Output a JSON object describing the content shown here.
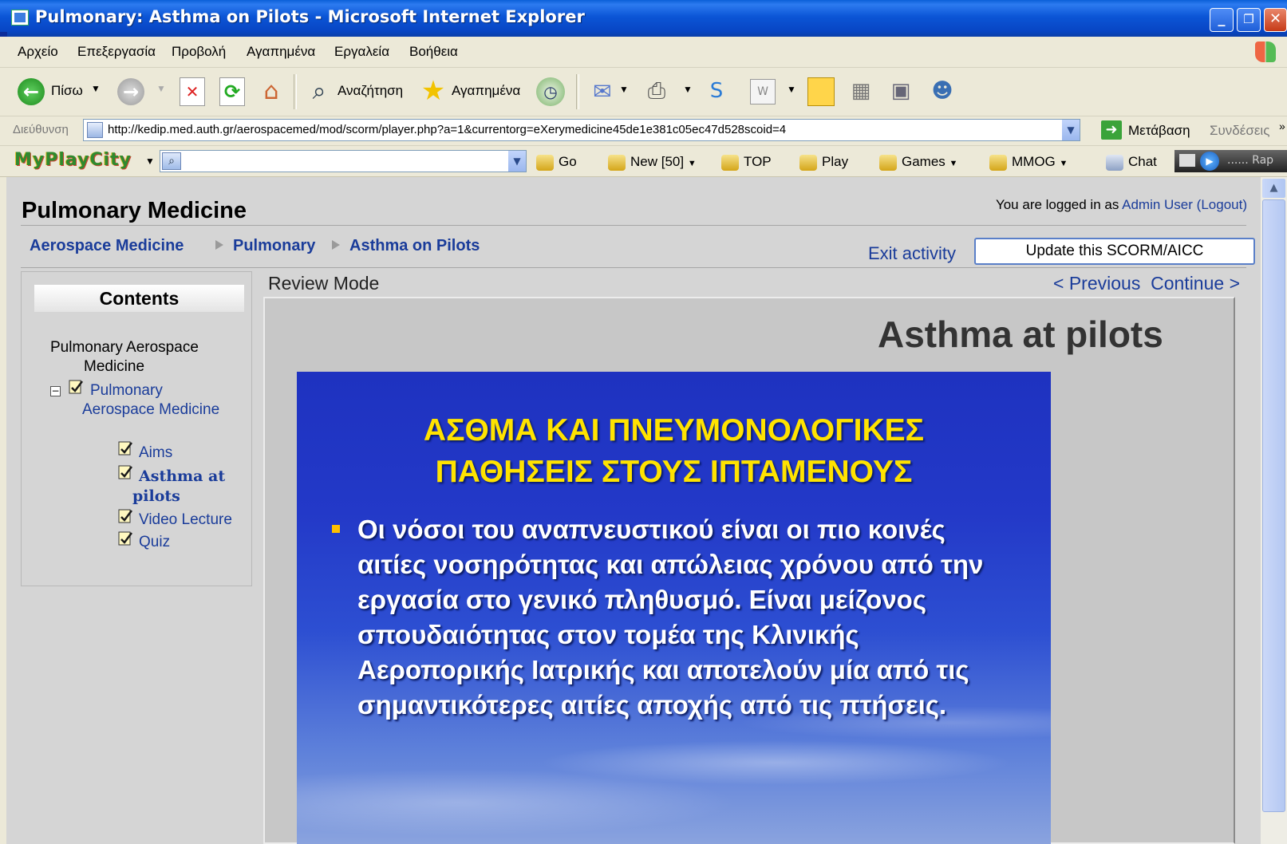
{
  "window": {
    "title": "Pulmonary: Asthma on Pilots - Microsoft Internet Explorer",
    "minimize": "_",
    "restore": "❐",
    "close": "✕"
  },
  "menu": [
    "Αρχείο",
    "Επεξεργασία",
    "Προβολή",
    "Αγαπημένα",
    "Εργαλεία",
    "Βοήθεια"
  ],
  "toolbar": {
    "back_label": "Πίσω",
    "search_label": "Αναζήτηση",
    "favorites_label": "Αγαπημένα"
  },
  "address": {
    "label": "Διεύθυνση",
    "url": "http://kedip.med.auth.gr/aerospacemed/mod/scorm/player.php?a=1&currentorg=eXerymedicine45de1e381c05ec47d528scoid=4",
    "go_label": "Μετάβαση",
    "links_label": "Συνδέσεις"
  },
  "linkbar": {
    "logo": "MyPlayCity",
    "go": "Go",
    "new": "New",
    "new_count": "[50]",
    "top": "TOP",
    "play": "Play",
    "games": "Games",
    "mmog": "MMOG",
    "chat": "Chat",
    "media_text": "...... Rap"
  },
  "page": {
    "site_title": "Pulmonary Medicine",
    "logged_prefix": "You are logged in as ",
    "user_name": "Admin User",
    "logout": "(Logout)",
    "breadcrumb": [
      "Aerospace Medicine",
      "Pulmonary",
      "Asthma on Pilots"
    ],
    "exit_activity": "Exit activity",
    "update_button": "Update this SCORM/AICC",
    "review_mode": "Review Mode",
    "previous": "< Previous",
    "continue": "Continue >"
  },
  "contents": {
    "heading": "Contents",
    "course_line1": "Pulmonary Aerospace",
    "course_line2": "Medicine",
    "folder_line1": "Pulmonary",
    "folder_line2": "Aerospace Medicine",
    "items": {
      "aims": "Aims",
      "asthma_line1": "Asthma at",
      "asthma_line2": "pilots",
      "video": "Video Lecture",
      "quiz": "Quiz"
    }
  },
  "slide": {
    "title": "Asthma at pilots",
    "heading_line1": "ΑΣΘΜΑ ΚΑΙ ΠΝΕΥΜΟΝΟΛΟΓΙΚΕΣ",
    "heading_line2": "ΠΑΘΗΣΕΙΣ ΣΤΟΥΣ ΙΠΤΑΜΕΝΟΥΣ",
    "body": "Οι νόσοι του αναπνευστικού είναι οι πιο κοινές αιτίες νοσηρότητας και απώλειας χρόνου από την εργασία στο γενικό πληθυσμό. Είναι μείζονος σπουδαιότητας στον τομέα της Κλινικής Αεροπορικής Ιατρικής και αποτελούν μία από τις σημαντικότερες αιτίες αποχής από τις πτήσεις."
  },
  "colors": {
    "titlebar": "#0A55D6",
    "link": "#1a3c9a",
    "slide_heading": "#FFE300",
    "slide_bg": "#2339c8"
  }
}
